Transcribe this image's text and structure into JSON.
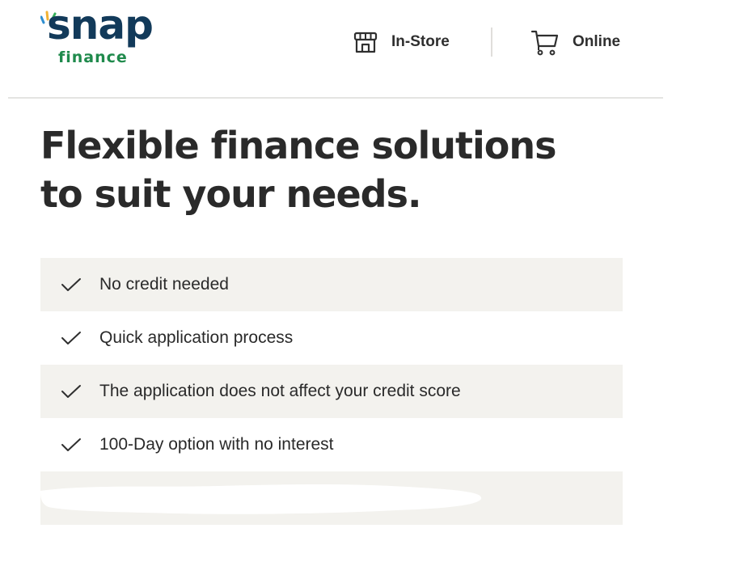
{
  "brand": {
    "logo_word": "snap",
    "logo_sub": "finance",
    "primary_color": "#123a5a",
    "accent_color": "#1f8a4c"
  },
  "nav": {
    "instore": {
      "label": "In-Store",
      "icon": "storefront-icon"
    },
    "online": {
      "label": "Online",
      "icon": "shopping-cart-icon"
    }
  },
  "headline": {
    "line1": "Flexible finance solutions",
    "line2": "to suit your needs."
  },
  "features": [
    {
      "text": "No credit needed",
      "icon": "checkmark-icon"
    },
    {
      "text": "Quick application process",
      "icon": "checkmark-icon"
    },
    {
      "text": "The application does not affect your credit score",
      "icon": "checkmark-icon"
    },
    {
      "text": "100-Day option with no interest",
      "icon": "checkmark-icon"
    }
  ]
}
